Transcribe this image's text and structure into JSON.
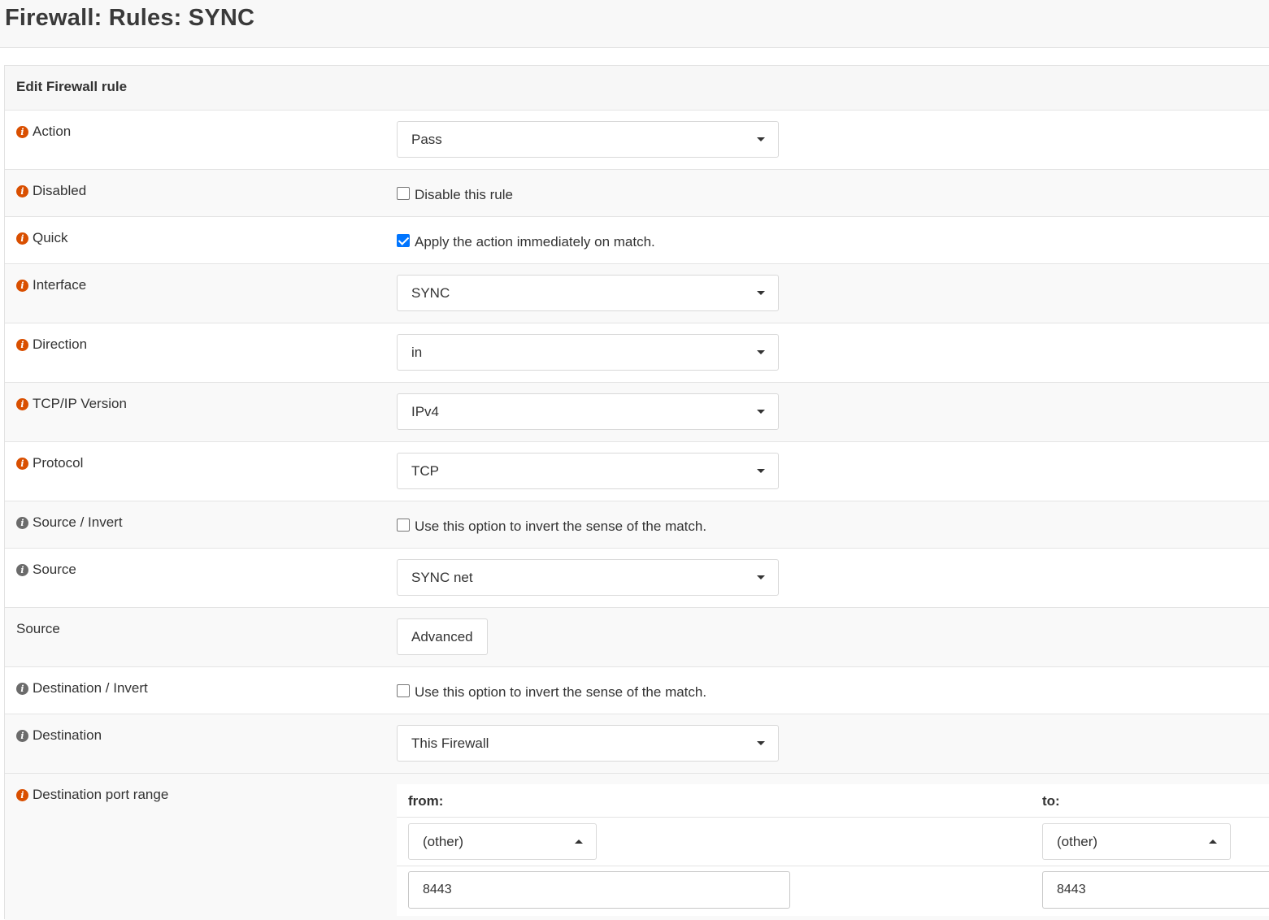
{
  "page": {
    "title": "Firewall: Rules: SYNC"
  },
  "panel": {
    "title": "Edit Firewall rule"
  },
  "fields": {
    "action": {
      "label": "Action",
      "value": "Pass"
    },
    "disabled": {
      "label": "Disabled",
      "checkbox_label": "Disable this rule",
      "checked": false
    },
    "quick": {
      "label": "Quick",
      "checkbox_label": "Apply the action immediately on match.",
      "checked": true
    },
    "interface": {
      "label": "Interface",
      "value": "SYNC"
    },
    "direction": {
      "label": "Direction",
      "value": "in"
    },
    "ipversion": {
      "label": "TCP/IP Version",
      "value": "IPv4"
    },
    "protocol": {
      "label": "Protocol",
      "value": "TCP"
    },
    "source_invert": {
      "label": "Source / Invert",
      "checkbox_label": "Use this option to invert the sense of the match.",
      "checked": false
    },
    "source": {
      "label": "Source",
      "value": "SYNC net"
    },
    "source_advanced": {
      "label": "Source",
      "button_label": "Advanced"
    },
    "destination_invert": {
      "label": "Destination / Invert",
      "checkbox_label": "Use this option to invert the sense of the match.",
      "checked": false
    },
    "destination": {
      "label": "Destination",
      "value": "This Firewall"
    },
    "dest_port_range": {
      "label": "Destination port range",
      "from_label": "from:",
      "to_label": "to:",
      "from_select": "(other)",
      "to_select": "(other)",
      "from_value": "8443",
      "to_value": "8443"
    }
  },
  "colors": {
    "info_icon_orange": "#d94f00",
    "info_icon_grey": "#6b6b6b",
    "checkbox_checked": "#0075ff"
  },
  "icons": {
    "info": "info-circle-icon",
    "dropdown": "caret-down-icon",
    "dropdown_open": "caret-up-icon"
  }
}
